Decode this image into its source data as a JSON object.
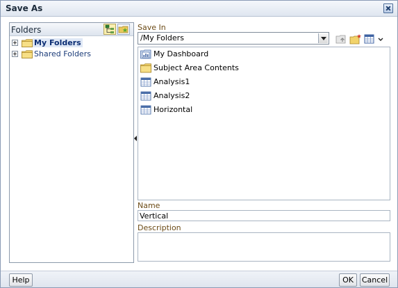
{
  "dialog": {
    "title": "Save As"
  },
  "folders": {
    "title": "Folders",
    "tree": [
      {
        "label": "My Folders",
        "selected": true
      },
      {
        "label": "Shared Folders",
        "selected": false
      }
    ]
  },
  "save_in": {
    "label": "Save In",
    "value": "/My Folders"
  },
  "contents": [
    {
      "label": "My Dashboard",
      "icon": "dashboard-icon"
    },
    {
      "label": "Subject Area Contents",
      "icon": "folder-icon"
    },
    {
      "label": "Analysis1",
      "icon": "analysis-icon"
    },
    {
      "label": "Analysis2",
      "icon": "analysis-icon"
    },
    {
      "label": "Horizontal",
      "icon": "analysis-icon"
    }
  ],
  "name": {
    "label": "Name",
    "value": "Vertical"
  },
  "description": {
    "label": "Description",
    "value": ""
  },
  "buttons": {
    "help": "Help",
    "ok": "OK",
    "cancel": "Cancel"
  },
  "colors": {
    "accent_label": "#6b4a15",
    "folder_yellow": "#f2d36b",
    "selected_text": "#0b2d73"
  }
}
